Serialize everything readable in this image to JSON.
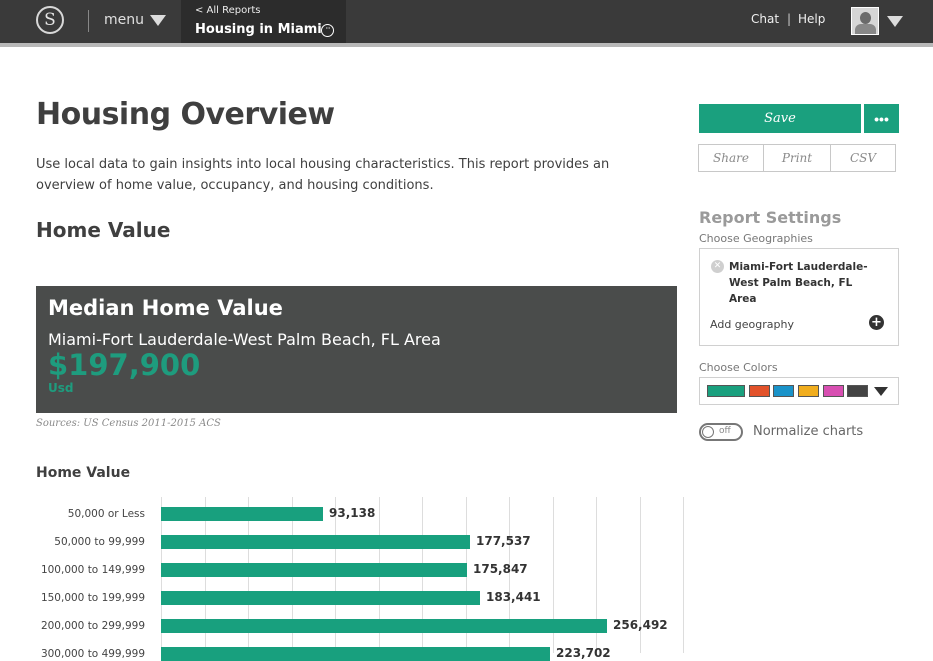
{
  "topbar": {
    "menu_label": "menu",
    "breadcrumb": "< All Reports",
    "report_title": "Housing in Miami",
    "chat_label": "Chat",
    "separator": "|",
    "help_label": "Help"
  },
  "main": {
    "title": "Housing Overview",
    "intro": "Use local data to gain insights into local housing characteristics. This report provides an overview of home value, occupancy, and housing conditions.",
    "section_title": "Home Value",
    "stat_card": {
      "title": "Median Home Value",
      "geography": "Miami-Fort Lauderdale-West Palm Beach, FL Area",
      "value": "$197,900",
      "unit": "Usd"
    },
    "sources": "Sources: US Census 2011-2015 ACS"
  },
  "chart_data": {
    "type": "bar",
    "orientation": "horizontal",
    "title": "Home Value",
    "categories": [
      "50,000 or Less",
      "50,000 to 99,999",
      "100,000 to 149,999",
      "150,000 to 199,999",
      "200,000 to 299,999",
      "300,000 to 499,999"
    ],
    "values": [
      93138,
      177537,
      175847,
      183441,
      256492,
      223702
    ],
    "value_labels": [
      "93,138",
      "177,537",
      "175,847",
      "183,441",
      "256,492",
      "223,702"
    ],
    "grid": true,
    "color": "#18a07e"
  },
  "sidebar": {
    "save_label": "Save",
    "more_label": "•••",
    "share_label": "Share",
    "print_label": "Print",
    "csv_label": "CSV",
    "settings_title": "Report Settings",
    "geographies_label": "Choose Geographies",
    "geography_name": "Miami-Fort Lauderdale-West Palm Beach, FL Area",
    "add_geography_label": "Add geography",
    "colors_label": "Choose Colors",
    "swatches": [
      "#1aa07e",
      "#e2522a",
      "#1a93c9",
      "#f0ad1e",
      "#d84fb2",
      "#444444"
    ],
    "toggle_state": "off",
    "normalize_label": "Normalize charts"
  },
  "icons": [
    "logo-icon",
    "menu-caret-icon",
    "options-icon",
    "avatar-icon",
    "remove-icon",
    "add-icon",
    "dropdown-caret-icon"
  ]
}
